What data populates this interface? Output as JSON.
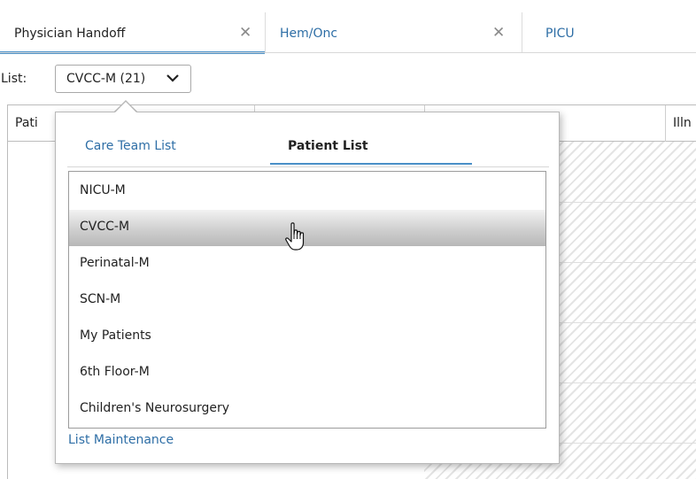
{
  "tabs": [
    {
      "label": "Physician Handoff",
      "close": "✕",
      "active": true
    },
    {
      "label": "Hem/Onc",
      "close": "✕",
      "active": false
    },
    {
      "label": "PICU",
      "active": false
    }
  ],
  "list_selector": {
    "label": "List:",
    "value": "CVCC-M (21)",
    "chevron_icon": "chevron-down-icon"
  },
  "grid": {
    "columns": [
      "Pati",
      "Illn"
    ]
  },
  "popup": {
    "tabs": [
      {
        "label": "Care Team List",
        "active": false
      },
      {
        "label": "Patient List",
        "active": true
      }
    ],
    "items": [
      {
        "label": "NICU-M"
      },
      {
        "label": "CVCC-M",
        "selected": true
      },
      {
        "label": "Perinatal-M"
      },
      {
        "label": "SCN-M"
      },
      {
        "label": "My Patients"
      },
      {
        "label": "6th Floor-M"
      },
      {
        "label": "Children's Neurosurgery"
      }
    ],
    "maintenance_link": "List Maintenance"
  },
  "colors": {
    "accent": "#4a90c8",
    "link": "#2e6ea6",
    "selected_row": "#c8c8c8"
  },
  "cursor_icon": "hand-pointer-icon"
}
